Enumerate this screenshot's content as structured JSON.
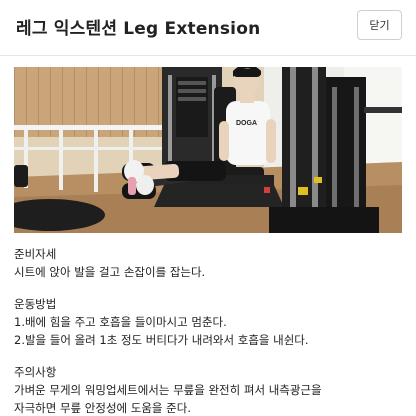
{
  "header": {
    "title": "레그 익스텐션 Leg Extension",
    "close_label": "닫기"
  },
  "photo": {
    "alt": "레그 익스텐션",
    "shirt_text": "DOGA"
  },
  "sections": [
    {
      "title": "준비자세",
      "lines": [
        "시트에 앉아 발을 걸고 손잡이를 잡는다."
      ]
    },
    {
      "title": "운동방법",
      "lines": [
        "1.배에 힘을 주고 호흡을 들이마시고 멈춘다.",
        "2.발을 들어 올려 1초 정도 버티다가 내려와서 호흡을 내쉰다."
      ]
    },
    {
      "title": "주의사항",
      "lines": [
        "가벼운 무게의 워밍업세트에서는 무릎을 완전히 펴서 내측광근을",
        "자극하면 무릎 안정성에 도움을 준다."
      ]
    }
  ],
  "colors": {
    "border": "#cfcfcf",
    "text": "#222222"
  }
}
